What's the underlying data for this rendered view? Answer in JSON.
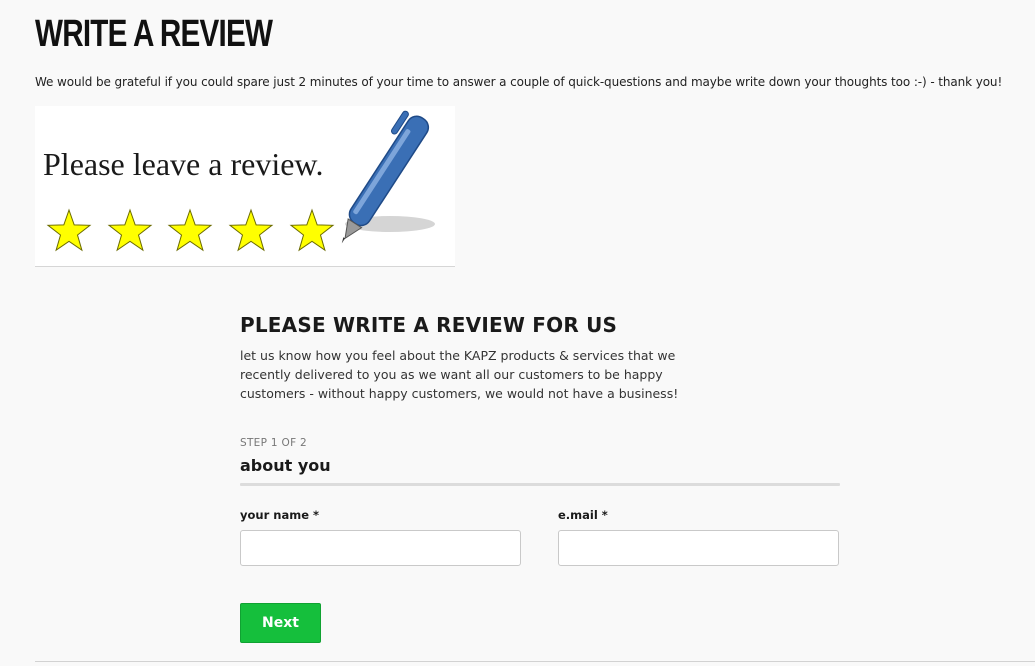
{
  "page": {
    "title": "WRITE A REVIEW",
    "intro": "We would be grateful if you could spare just 2 minutes of your time to answer a couple of quick-questions and maybe write down your thoughts too :-) - thank you!"
  },
  "banner": {
    "text": "Please leave a review.",
    "stars": 5,
    "star_color": "#ffff00",
    "pen_color": "#3a6fb5"
  },
  "form": {
    "title": "PLEASE WRITE A REVIEW FOR US",
    "description": "let us know how you feel about the KAPZ products & services that we recently delivered to you as we want all our customers to be happy customers - without happy customers, we would not have a business!",
    "step": "STEP 1 OF 2",
    "section_title": "about you",
    "fields": {
      "name_label": "your name *",
      "name_value": "",
      "email_label": "e.mail *",
      "email_value": ""
    },
    "next_label": "Next",
    "next_color": "#15bf3c"
  }
}
